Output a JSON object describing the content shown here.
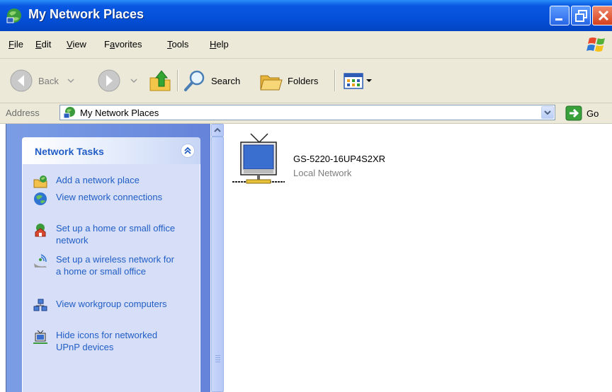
{
  "window": {
    "title": "My Network Places"
  },
  "menu": [
    {
      "label": "File",
      "mnemonic_index": 0
    },
    {
      "label": "Edit",
      "mnemonic_index": 0
    },
    {
      "label": "View",
      "mnemonic_index": 0
    },
    {
      "label": "Favorites",
      "mnemonic_index": 1
    },
    {
      "label": "Tools",
      "mnemonic_index": 0
    },
    {
      "label": "Help",
      "mnemonic_index": 0
    }
  ],
  "toolbar": {
    "back_label": "Back",
    "search_label": "Search",
    "folders_label": "Folders"
  },
  "address": {
    "label": "Address",
    "value": "My Network Places",
    "go_label": "Go"
  },
  "tasks": {
    "header": "Network Tasks",
    "items": [
      {
        "label": "Add a network place",
        "icon": "add-network-place-icon"
      },
      {
        "label": "View network connections",
        "icon": "network-connections-icon"
      },
      {
        "label": "Set up a home or small office network",
        "icon": "home-network-icon"
      },
      {
        "label": "Set up a wireless network for a home or small office",
        "icon": "wireless-network-icon"
      },
      {
        "label": "View workgroup computers",
        "icon": "workgroup-icon"
      },
      {
        "label": "Hide icons for networked UPnP devices",
        "icon": "upnp-device-icon"
      }
    ]
  },
  "content": {
    "items": [
      {
        "name": "GS-5220-16UP4S2XR",
        "description": "Local Network",
        "icon": "upnp-device-icon"
      }
    ]
  },
  "colors": {
    "titlebar": "#0450d8",
    "taskpane": "#6584da",
    "task_link": "#215dc6"
  }
}
